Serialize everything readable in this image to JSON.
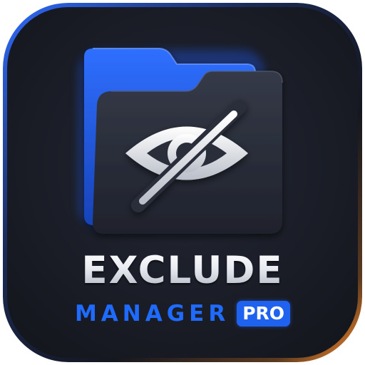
{
  "app_icon": {
    "title": "EXCLUDE",
    "subtitle": "MANAGER",
    "badge": "PRO",
    "icon_names": [
      "folder-icon",
      "eye-slash-icon"
    ],
    "colors": {
      "background": "#1a1d26",
      "accent_blue": "#1f6bff",
      "badge_blue": "#1f62f0",
      "folder_front": "#2a2e3a",
      "edge_glow_orange": "#ff8a2a",
      "title_silver": "#e9ecf2"
    }
  }
}
